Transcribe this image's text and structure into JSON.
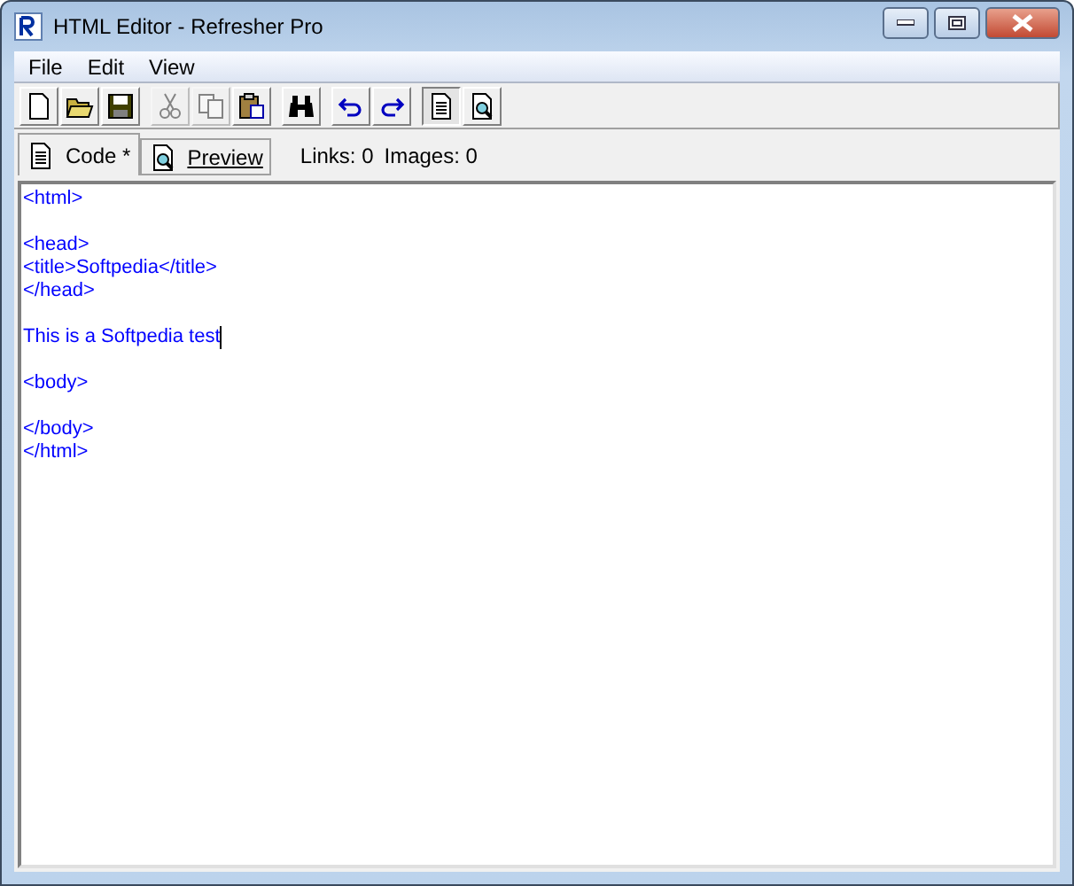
{
  "window": {
    "title": "HTML Editor - Refresher Pro"
  },
  "menu": [
    "File",
    "Edit",
    "View"
  ],
  "toolbar": [
    [
      {
        "disabled": false,
        "selected": false
      },
      {
        "disabled": false,
        "selected": false
      },
      {
        "disabled": false,
        "selected": false
      }
    ],
    [
      {
        "disabled": true,
        "selected": false
      },
      {
        "disabled": true,
        "selected": false
      },
      {
        "disabled": false,
        "selected": false
      }
    ],
    [
      {
        "disabled": false,
        "selected": false
      }
    ],
    [
      {
        "disabled": false,
        "selected": false
      },
      {
        "disabled": false,
        "selected": false
      }
    ],
    [
      {
        "disabled": false,
        "selected": true
      },
      {
        "disabled": false,
        "selected": false
      }
    ]
  ],
  "tabs": [
    {
      "label": "Code *",
      "selected": true
    },
    {
      "label": "Preview",
      "selected": false
    }
  ],
  "stats": [
    "Links: 0",
    "Images: 0"
  ],
  "editor": {
    "blocks": [
      {
        "lines": [
          "<html>"
        ],
        "caret": false
      },
      {
        "lines": [
          "<head>",
          "<title>Softpedia</title>",
          "</head>"
        ],
        "caret": false
      },
      {
        "lines": [
          "This is a Softpedia test"
        ],
        "caret": true
      },
      {
        "lines": [
          "<body>"
        ],
        "caret": false
      },
      {
        "lines": [
          "</body>",
          "</html>"
        ],
        "caret": false
      }
    ]
  }
}
